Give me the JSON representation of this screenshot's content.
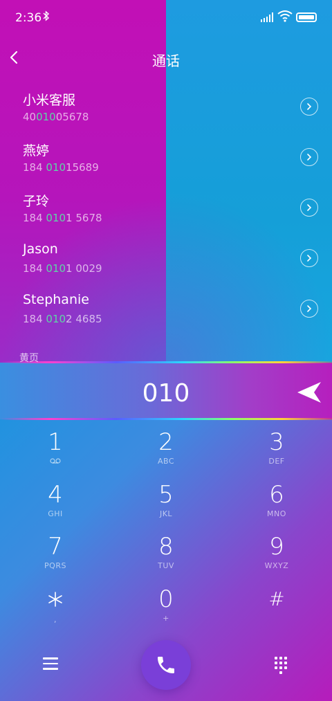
{
  "status_bar": {
    "time": "2:36",
    "bluetooth_glyph": "ᛒ"
  },
  "header": {
    "title": "通话"
  },
  "contacts": [
    {
      "name": "小米客服",
      "number_pre": "40",
      "number_hl": "010",
      "number_post": "05678"
    },
    {
      "name": "燕婷",
      "number_pre": "184 ",
      "number_hl": "010",
      "number_post": "15689"
    },
    {
      "name": "子玲",
      "number_pre": "184 ",
      "number_hl": "010",
      "number_post": "1 5678"
    },
    {
      "name": "Jason",
      "number_pre": "184 ",
      "number_hl": "010",
      "number_post": "1 0029"
    },
    {
      "name": "Stephanie",
      "number_pre": "184 ",
      "number_hl": "010",
      "number_post": "2 4685"
    }
  ],
  "section_label": "黄页",
  "dialer": {
    "entered_number": "010"
  },
  "keypad": [
    {
      "digit": "1",
      "letters": "ꝏ"
    },
    {
      "digit": "2",
      "letters": "ABC"
    },
    {
      "digit": "3",
      "letters": "DEF"
    },
    {
      "digit": "4",
      "letters": "GHI"
    },
    {
      "digit": "5",
      "letters": "JKL"
    },
    {
      "digit": "6",
      "letters": "MNO"
    },
    {
      "digit": "7",
      "letters": "PQRS"
    },
    {
      "digit": "8",
      "letters": "TUV"
    },
    {
      "digit": "9",
      "letters": "WXYZ"
    },
    {
      "digit": "⁎",
      "letters": ","
    },
    {
      "digit": "0",
      "letters": "+"
    },
    {
      "digit": "#",
      "letters": ""
    }
  ],
  "colors": {
    "highlight": "#5ed6a6",
    "call_button": "#7a3fd8"
  }
}
